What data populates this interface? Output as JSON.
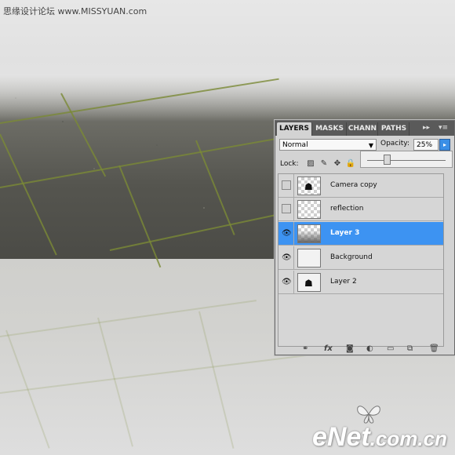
{
  "site_watermark": "思缘设计论坛 www.MISSYUAN.com",
  "panel": {
    "tabs": [
      "LAYERS",
      "MASKS",
      "CHANN",
      "PATHS"
    ],
    "blend_mode": "Normal",
    "opacity_label": "Opacity:",
    "opacity_value": "25%",
    "opacity_slider_fraction": 0.25,
    "lock_label": "Lock:",
    "layers": [
      {
        "name": "Camera copy",
        "visible": false,
        "selected": false
      },
      {
        "name": "reflection",
        "visible": false,
        "selected": false
      },
      {
        "name": "Layer 3",
        "visible": true,
        "selected": true
      },
      {
        "name": "Background",
        "visible": true,
        "selected": false
      },
      {
        "name": "Layer 2",
        "visible": true,
        "selected": false
      }
    ],
    "footer_icons": [
      "link-icon",
      "fx-icon",
      "mask-icon",
      "adjustment-icon",
      "folder-icon",
      "new-layer-icon",
      "trash-icon"
    ]
  },
  "enet_watermark": {
    "part1": "eNet",
    "part2": ".com.cn"
  },
  "colors": {
    "accent": "#3d93f2",
    "grout": "#7a8a36"
  }
}
